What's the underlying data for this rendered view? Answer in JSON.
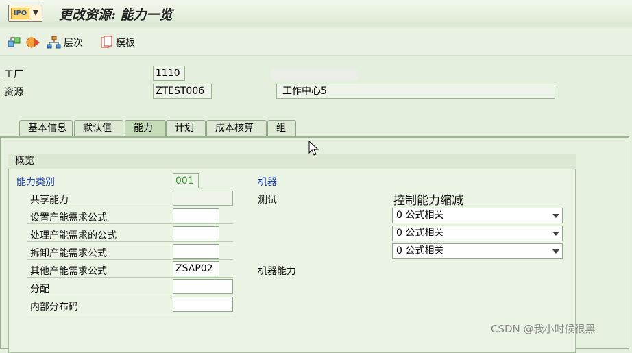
{
  "window": {
    "title": "更改资源: 能力一览",
    "app_icon_text": "IPO"
  },
  "toolbar": {
    "items": [
      {
        "name": "other-object-button",
        "label": ""
      },
      {
        "name": "flow-button",
        "label": ""
      },
      {
        "name": "hierarchy-button",
        "label": "层次"
      },
      {
        "name": "template-button",
        "label": "模板"
      }
    ]
  },
  "header": {
    "plant_label": "工厂",
    "plant_value": "1110",
    "resource_label": "资源",
    "resource_value": "ZTEST006",
    "resource_desc": "工作中心5"
  },
  "tabs": [
    "基本信息",
    "默认值",
    "能力",
    "计划",
    "成本核算",
    "组"
  ],
  "active_tab": "能力",
  "overview": {
    "title": "概览",
    "capacity_category_label": "能力类别",
    "capacity_category_value": "001",
    "capacity_category_text": "机器",
    "rows": [
      {
        "label": "共享能力",
        "value": "",
        "text": "测试"
      },
      {
        "label": "设置产能需求公式",
        "value": ""
      },
      {
        "label": "处理产能需求的公式",
        "value": ""
      },
      {
        "label": "拆卸产能需求公式",
        "value": ""
      },
      {
        "label": "其他产能需求公式",
        "value": "ZSAP02",
        "text": "机器能力"
      },
      {
        "label": "分配",
        "value": ""
      },
      {
        "label": "内部分布码",
        "value": ""
      }
    ],
    "reduction_title": "控制能力缩减",
    "reduction_options": [
      "0 公式相关",
      "0 公式相关",
      "0 公式相关"
    ]
  },
  "watermark": "CSDN @我小时候很黑",
  "colors": {
    "panel_bg": "#e6f0df",
    "accent_blue": "#1a3fa8",
    "accent_green": "#3c9b2d"
  }
}
